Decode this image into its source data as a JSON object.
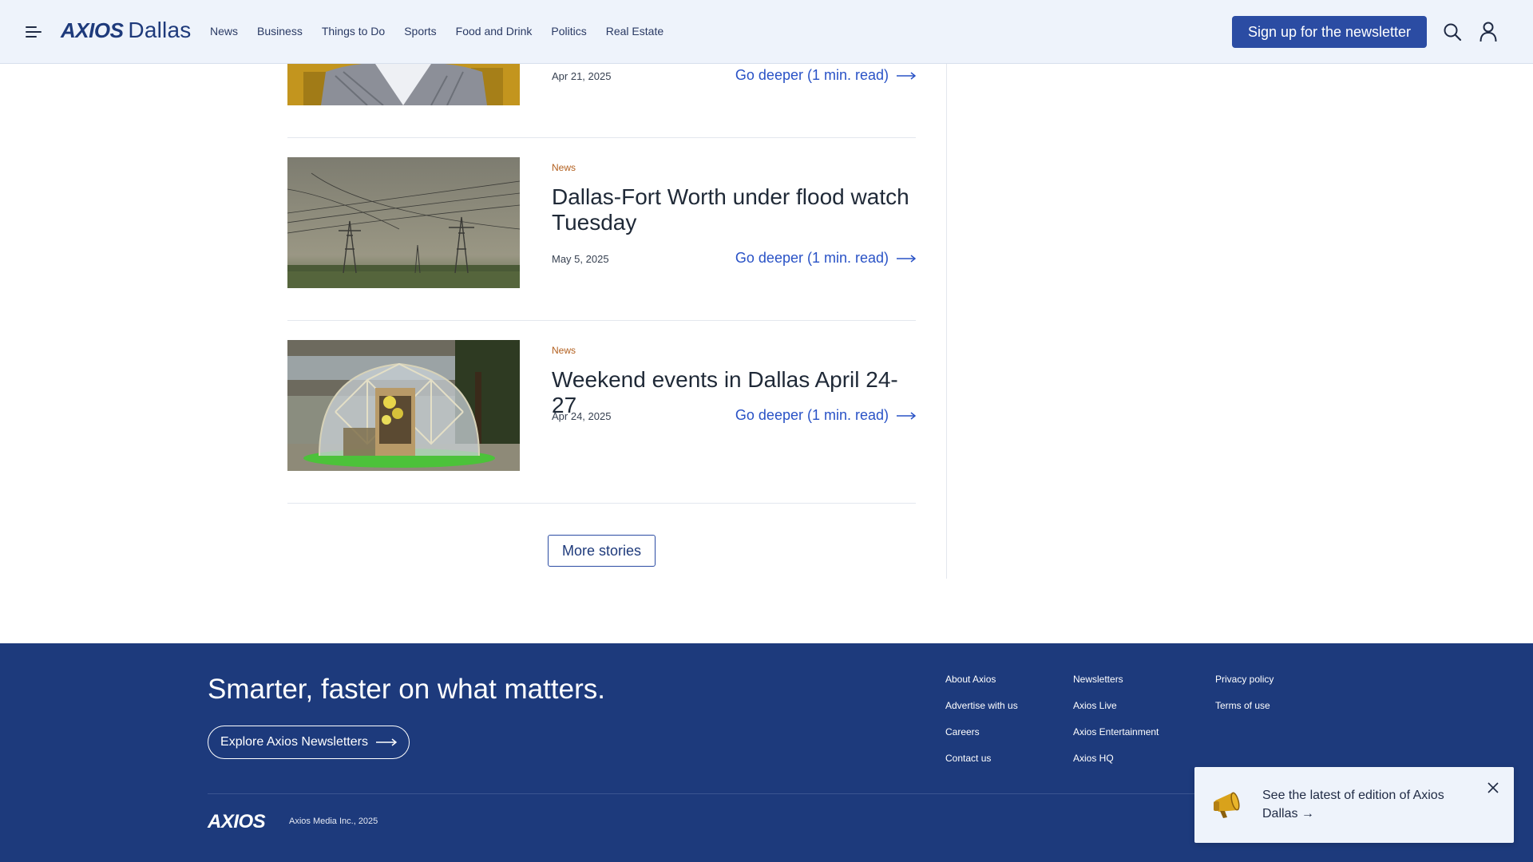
{
  "header": {
    "logo_brand": "AXIOS",
    "logo_city": "Dallas",
    "nav": [
      "News",
      "Business",
      "Things to Do",
      "Sports",
      "Food and Drink",
      "Politics",
      "Real Estate"
    ],
    "signup_label": "Sign up for the newsletter"
  },
  "stories": [
    {
      "date": "Apr 21, 2025",
      "cta": "Go deeper (1 min. read)"
    },
    {
      "category": "News",
      "headline": "Dallas-Fort Worth under flood watch Tuesday",
      "date": "May 5, 2025",
      "cta": "Go deeper (1 min. read)"
    },
    {
      "category": "News",
      "headline": "Weekend events in Dallas April 24-27",
      "date": "Apr 24, 2025",
      "cta": "Go deeper (1 min. read)"
    }
  ],
  "more_label": "More stories",
  "footer": {
    "tagline": "Smarter, faster on what matters.",
    "explore_label": "Explore Axios Newsletters",
    "col1": [
      "About Axios",
      "Advertise with us",
      "Careers",
      "Contact us"
    ],
    "col2": [
      "Newsletters",
      "Axios Live",
      "Axios Entertainment",
      "Axios HQ"
    ],
    "col3": [
      "Privacy policy",
      "Terms of use"
    ],
    "logo": "AXIOS",
    "copyright": "Axios Media Inc., 2025"
  },
  "toast": {
    "text": "See the latest of edition of Axios Dallas →"
  },
  "colors": {
    "brand_navy": "#1d3a7c",
    "link_blue": "#2952c6",
    "category_orange": "#b25f1e"
  }
}
